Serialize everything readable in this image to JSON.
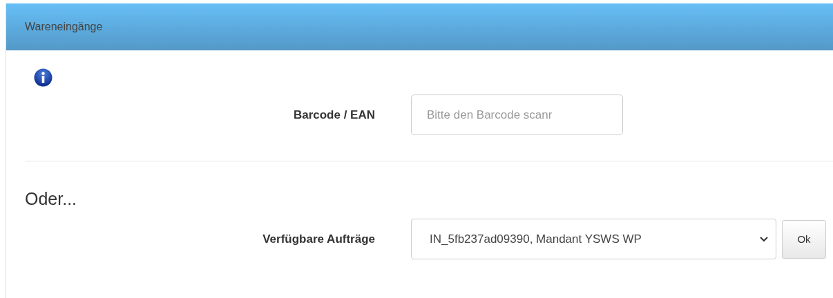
{
  "panel": {
    "title": "Wareneingänge"
  },
  "barcode": {
    "label": "Barcode / EAN",
    "placeholder": "Bitte den Barcode scanr"
  },
  "alternative": {
    "heading": "Oder...",
    "label": "Verfügbare Aufträge",
    "value": "IN_5fb237ad09390, Mandant YSWS WP",
    "button": "Ok"
  }
}
